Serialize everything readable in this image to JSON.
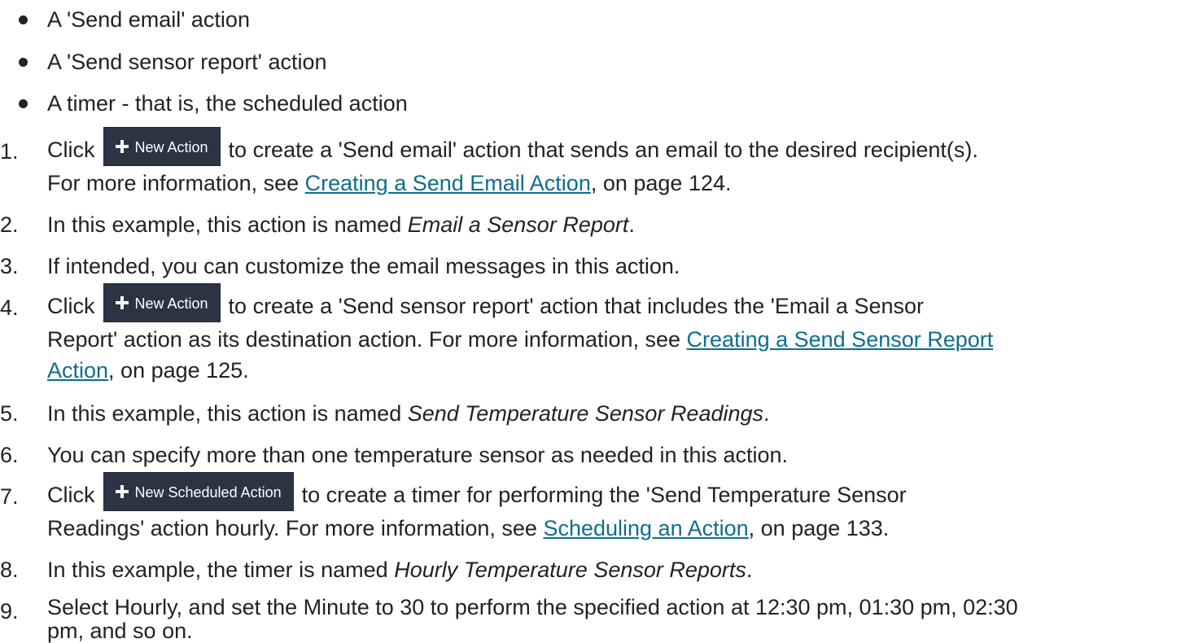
{
  "bullets": [
    "A 'Send email' action",
    "A 'Send sensor report' action",
    "A timer - that is, the scheduled action"
  ],
  "buttons": {
    "new_action": "New Action",
    "new_scheduled_action": "New Scheduled Action"
  },
  "steps": {
    "s1": {
      "num": "1.",
      "click": "Click",
      "after_button": "to create a 'Send email' action that sends an email to the desired recipient(s).",
      "more_info": "For more information, see",
      "link": "Creating a Send Email Action",
      "page_ref": ", on page 124."
    },
    "s2": {
      "num": "2.",
      "before": "In this example, this action is named",
      "name": "Email a Sensor Report",
      "after": "."
    },
    "s3": {
      "num": "3.",
      "text": "If intended, you can customize the email messages in this action."
    },
    "s4": {
      "num": "4.",
      "click": "Click",
      "after_button": "to create a 'Send sensor report' action that includes the 'Email a Sensor",
      "line2": "Report' action as its destination action. For more information, see",
      "link_part1": "Creating a Send Sensor Report",
      "link_part2": "Action",
      "page_ref": ", on page 125."
    },
    "s5": {
      "num": "5.",
      "before": "In this example, this action is named",
      "name": "Send Temperature Sensor Readings",
      "after": "."
    },
    "s6": {
      "num": "6.",
      "text": "You can specify more than one temperature sensor as needed in this action."
    },
    "s7": {
      "num": "7.",
      "click": "Click",
      "after_button": "to create a timer for performing the 'Send Temperature Sensor",
      "line2": "Readings' action hourly. For more information, see",
      "link": "Scheduling an Action",
      "page_ref": ", on page 133."
    },
    "s8": {
      "num": "8.",
      "before": "In this example, the timer is named",
      "name": "Hourly Temperature Sensor Reports",
      "after": "."
    },
    "s9": {
      "num": "9.",
      "line1": "Select Hourly, and set the Minute to 30 to perform the specified action at 12:30 pm, 01:30 pm, 02:30",
      "line2": "pm, and so on."
    }
  }
}
